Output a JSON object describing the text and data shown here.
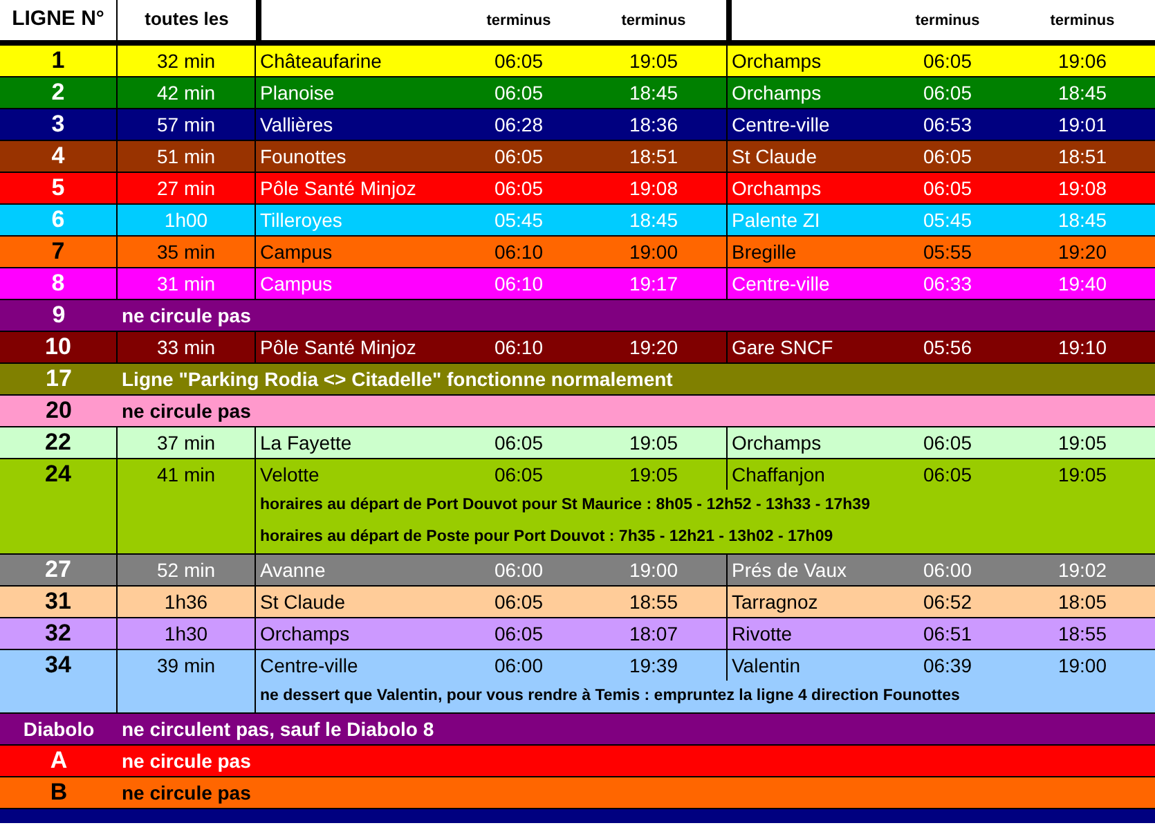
{
  "header": {
    "line": "LIGNE N°",
    "frequency": "toutes les",
    "columns": [
      "terminus",
      "terminus",
      "terminus",
      "terminus"
    ]
  },
  "rows": [
    {
      "kind": "service",
      "line": "1",
      "color": "#ffff00",
      "frequency": "32 min",
      "origin": "Châteaufarine",
      "origin_first": "06:05",
      "origin_last": "19:05",
      "destination": "Orchamps",
      "destination_first": "06:05",
      "destination_last": "19:06"
    },
    {
      "kind": "service",
      "line": "2",
      "color": "#008000",
      "frequency": "42 min",
      "origin": "Planoise",
      "origin_first": "06:05",
      "origin_last": "18:45",
      "destination": "Orchamps",
      "destination_first": "06:05",
      "destination_last": "18:45"
    },
    {
      "kind": "service",
      "line": "3",
      "color": "#000080",
      "frequency": "57 min",
      "origin": "Vallières",
      "origin_first": "06:28",
      "origin_last": "18:36",
      "destination": "Centre-ville",
      "destination_first": "06:53",
      "destination_last": "19:01"
    },
    {
      "kind": "service",
      "line": "4",
      "color": "#993300",
      "frequency": "51 min",
      "origin": "Founottes",
      "origin_first": "06:05",
      "origin_last": "18:51",
      "destination": "St Claude",
      "destination_first": "06:05",
      "destination_last": "18:51"
    },
    {
      "kind": "service",
      "line": "5",
      "color": "#ff0000",
      "frequency": "27 min",
      "origin": "Pôle Santé Minjoz",
      "origin_first": "06:05",
      "origin_last": "19:08",
      "destination": "Orchamps",
      "destination_first": "06:05",
      "destination_last": "19:08"
    },
    {
      "kind": "service",
      "line": "6",
      "color": "#00ccff",
      "frequency": "1h00",
      "origin": "Tilleroyes",
      "origin_first": "05:45",
      "origin_last": "18:45",
      "destination": "Palente ZI",
      "destination_first": "05:45",
      "destination_last": "18:45"
    },
    {
      "kind": "service",
      "line": "7",
      "color": "#ff6600",
      "frequency": "35 min",
      "origin": "Campus",
      "origin_first": "06:10",
      "origin_last": "19:00",
      "destination": "Bregille",
      "destination_first": "05:55",
      "destination_last": "19:20"
    },
    {
      "kind": "service",
      "line": "8",
      "color": "#ff00ff",
      "frequency": "31 min",
      "origin": "Campus",
      "origin_first": "06:10",
      "origin_last": "19:17",
      "destination": "Centre-ville",
      "destination_first": "06:33",
      "destination_last": "19:40"
    },
    {
      "kind": "notice",
      "line": "9",
      "color": "#800080",
      "text": "ne circule pas"
    },
    {
      "kind": "service",
      "line": "10",
      "color": "#800000",
      "frequency": "33 min",
      "origin": "Pôle Santé Minjoz",
      "origin_first": "06:10",
      "origin_last": "19:20",
      "destination": "Gare SNCF",
      "destination_first": "05:56",
      "destination_last": "19:10"
    },
    {
      "kind": "notice",
      "line": "17",
      "color": "#808000",
      "text": "Ligne \"Parking Rodia <> Citadelle\" fonctionne normalement"
    },
    {
      "kind": "notice",
      "line": "20",
      "color": "#ff99cc",
      "text": "ne circule pas"
    },
    {
      "kind": "service",
      "line": "22",
      "color": "#ccffcc",
      "frequency": "37 min",
      "origin": "La Fayette",
      "origin_first": "06:05",
      "origin_last": "19:05",
      "destination": "Orchamps",
      "destination_first": "06:05",
      "destination_last": "19:05"
    },
    {
      "kind": "service",
      "line": "24",
      "color": "#99cc00",
      "frequency": "41 min",
      "origin": "Velotte",
      "origin_first": "06:05",
      "origin_last": "19:05",
      "destination": "Chaffanjon",
      "destination_first": "06:05",
      "destination_last": "19:05",
      "notes": [
        "horaires au départ de Port Douvot pour St Maurice : 8h05 - 12h52 - 13h33 - 17h39",
        "horaires au départ de Poste pour Port Douvot : 7h35 - 12h21 - 13h02 - 17h09"
      ]
    },
    {
      "kind": "service",
      "line": "27",
      "color": "#808080",
      "frequency": "52 min",
      "origin": "Avanne",
      "origin_first": "06:00",
      "origin_last": "19:00",
      "destination": "Prés de Vaux",
      "destination_first": "06:00",
      "destination_last": "19:02"
    },
    {
      "kind": "service",
      "line": "31",
      "color": "#ffcc99",
      "frequency": "1h36",
      "origin": "St Claude",
      "origin_first": "06:05",
      "origin_last": "18:55",
      "destination": "Tarragnoz",
      "destination_first": "06:52",
      "destination_last": "18:05"
    },
    {
      "kind": "service",
      "line": "32",
      "color": "#cc99ff",
      "frequency": "1h30",
      "origin": "Orchamps",
      "origin_first": "06:05",
      "origin_last": "18:07",
      "destination": "Rivotte",
      "destination_first": "06:51",
      "destination_last": "18:55"
    },
    {
      "kind": "service",
      "line": "34",
      "color": "#99ccff",
      "frequency": "39 min",
      "origin": "Centre-ville",
      "origin_first": "06:00",
      "origin_last": "19:39",
      "destination": "Valentin",
      "destination_first": "06:39",
      "destination_last": "19:00",
      "notes": [
        "ne dessert que Valentin, pour vous rendre à Temis : empruntez la ligne 4 direction Founottes"
      ]
    },
    {
      "kind": "notice",
      "line": "Diabolo",
      "color": "#800080",
      "text": "ne circulent pas, sauf le Diabolo 8"
    },
    {
      "kind": "notice",
      "line": "A",
      "color": "#ff0000",
      "text": "ne circule pas"
    },
    {
      "kind": "notice",
      "line": "B",
      "color": "#ff6600",
      "text": "ne circule pas"
    },
    {
      "kind": "band",
      "color": "#000080"
    }
  ]
}
